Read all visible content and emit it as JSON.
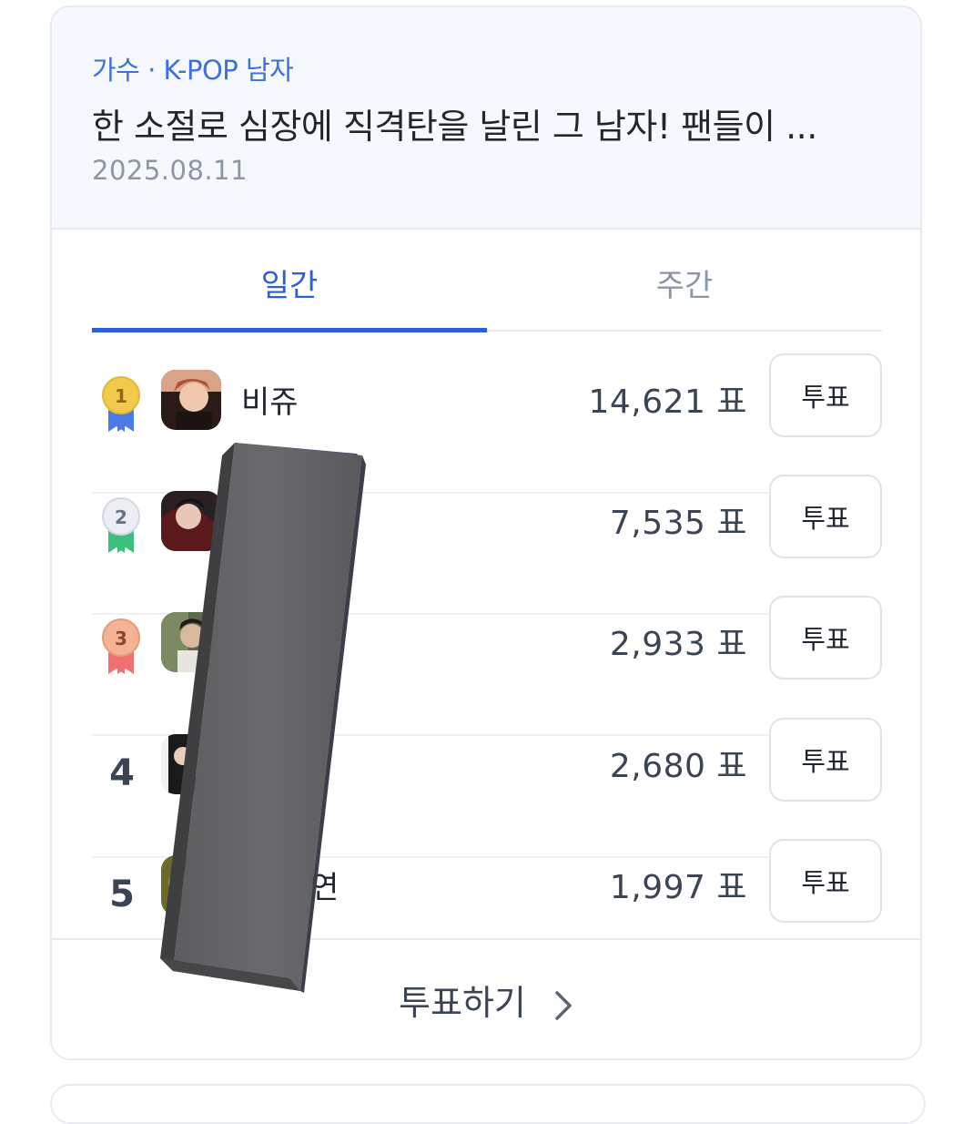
{
  "header": {
    "category": "가수 · K-POP 남자",
    "headline": "한 소절로 심장에 직격탄을 날린 그 남자! 팬들이 ...",
    "date": "2025.08.11"
  },
  "tabs": {
    "daily": "일간",
    "weekly": "주간",
    "active": "daily"
  },
  "rankings": [
    {
      "rank": "1",
      "medal": "gold",
      "name": "비쥬",
      "votes": "14,621 표",
      "button": "투표"
    },
    {
      "rank": "2",
      "medal": "silver",
      "name": "",
      "votes": "7,535 표",
      "button": "투표"
    },
    {
      "rank": "3",
      "medal": "bronze",
      "name": "",
      "votes": "2,933 표",
      "button": "투표"
    },
    {
      "rank": "4",
      "medal": "",
      "name": "",
      "votes": "2,680 표",
      "button": "투표"
    },
    {
      "rank": "5",
      "medal": "",
      "name": "연",
      "votes": "1,997 표",
      "button": "투표"
    }
  ],
  "footer": {
    "vote_link": "투표하기"
  },
  "colors": {
    "accent": "#2f5fd6",
    "gold": "#f2c94c",
    "silver": "#e6e8ee",
    "bronze": "#f2a98a"
  }
}
